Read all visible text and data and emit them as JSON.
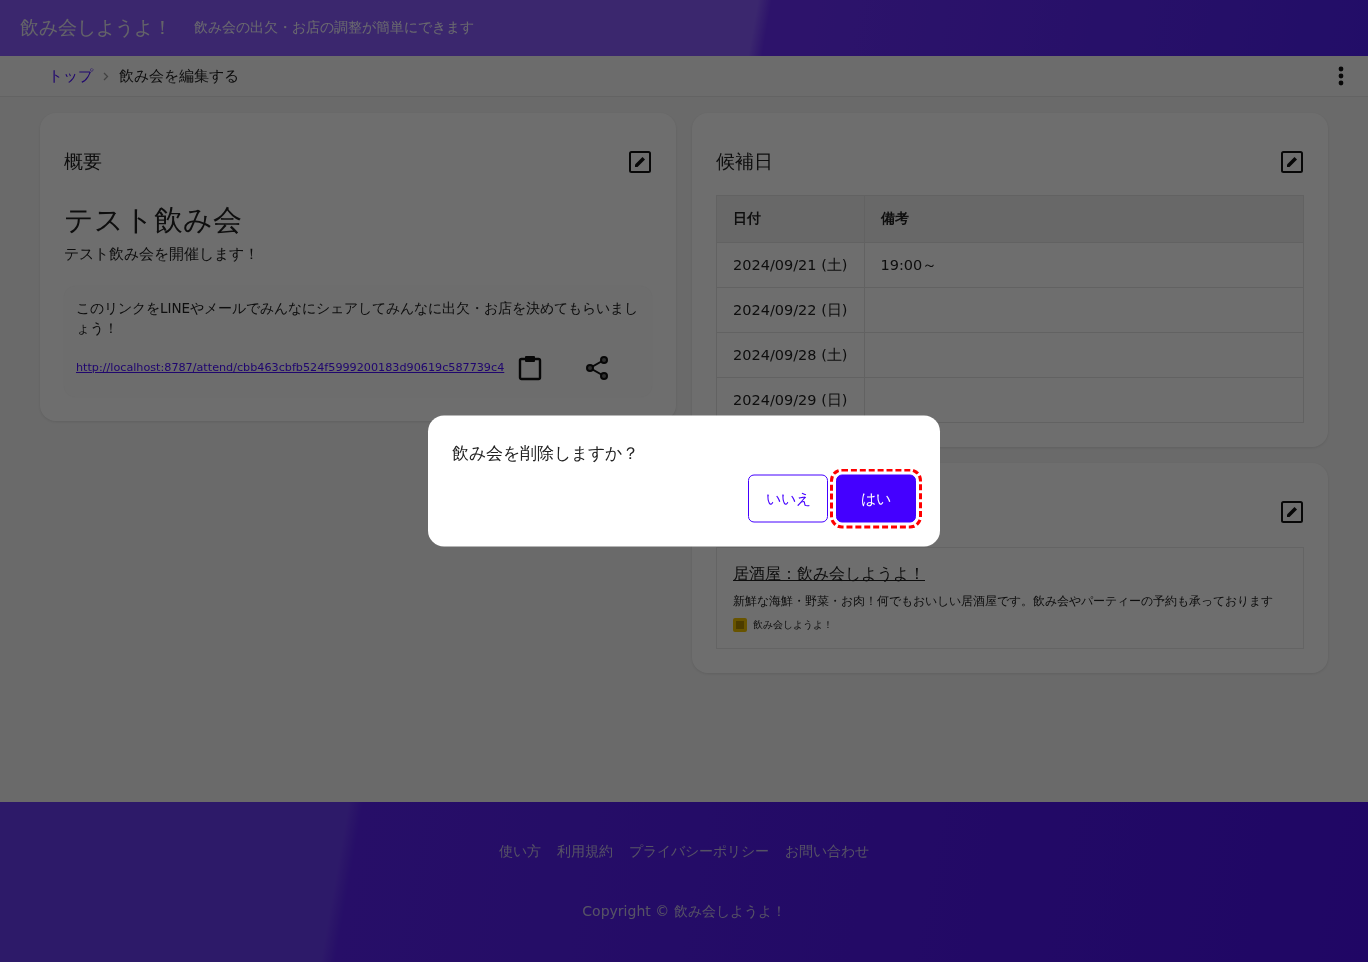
{
  "header": {
    "title": "飲み会しようよ！",
    "subtitle": "飲み会の出欠・お店の調整が簡単にできます"
  },
  "breadcrumb": [
    {
      "label": "トップ",
      "kind": "link"
    },
    {
      "label": "飲み会を編集する",
      "kind": "current"
    }
  ],
  "overview": {
    "heading": "概要",
    "event_name": "テスト飲み会",
    "description": "テスト飲み会を開催します！",
    "share_note": "このリンクをLINEやメールでみんなにシェアしてみんなに出欠・お店を決めてもらいましょう！",
    "share_url": "http://localhost:8787/attend/cbb463cbfb524f5999200183d90619c587739c4"
  },
  "candidates": {
    "heading": "候補日",
    "columns": [
      "日付",
      "備考"
    ],
    "rows": [
      [
        "2024/09/21 (土)",
        "19:00～"
      ],
      [
        "2024/09/22 (日)",
        ""
      ],
      [
        "2024/09/28 (土)",
        ""
      ],
      [
        "2024/09/29 (日)",
        ""
      ]
    ]
  },
  "shop": {
    "link_title": "居酒屋：飲み会しようよ！",
    "description": "新鮮な海鮮・野菜・お肉！何でもおいしい居酒屋です。飲み会やパーティーの予約も承っております",
    "source": "飲み会しようよ！"
  },
  "dialog": {
    "message": "飲み会を削除しますか？",
    "buttons": [
      {
        "label": "いいえ",
        "kind": "secondary",
        "focused": false
      },
      {
        "label": "はい",
        "kind": "primary",
        "focused": true
      }
    ]
  },
  "footer": {
    "links": [
      "使い方",
      "利用規約",
      "プライバシーポリシー",
      "お問い合わせ"
    ],
    "copyright": "Copyright © 飲み会しようよ！"
  }
}
